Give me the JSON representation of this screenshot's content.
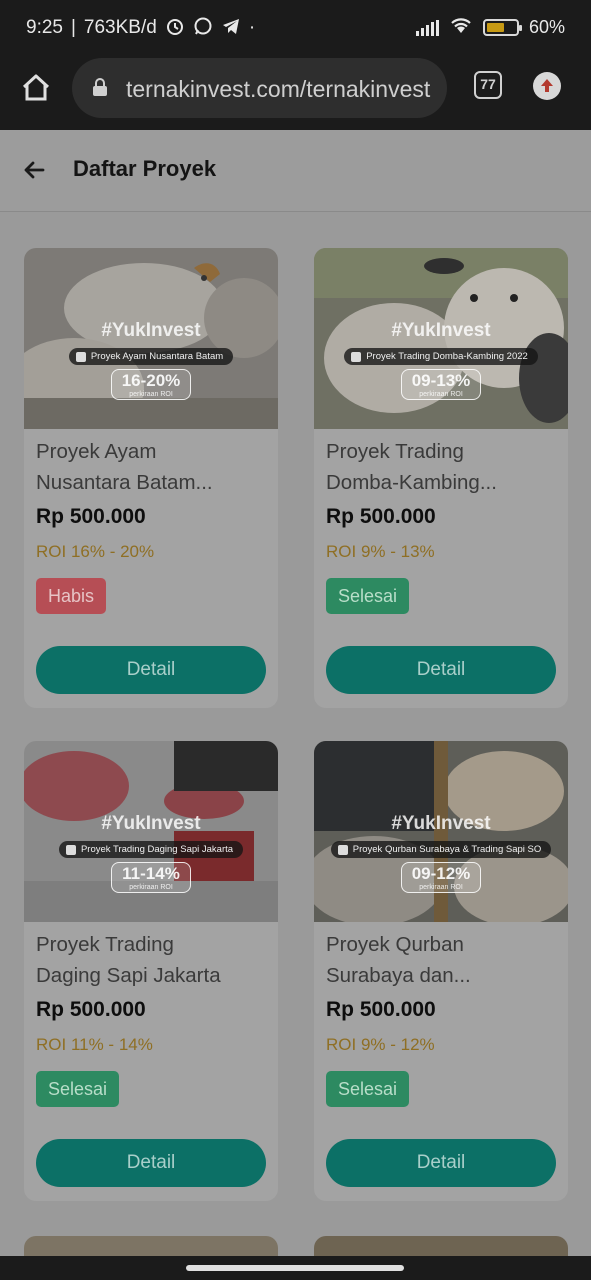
{
  "status_bar": {
    "time": "9:25",
    "separator": "|",
    "net_speed": "763KB/d",
    "dot": "·",
    "battery_pct": "60%",
    "battery_level": 0.6,
    "icons": [
      "alarm-icon",
      "whatsapp-icon",
      "telegram-icon",
      "signal-icon",
      "wifi-icon",
      "battery-icon"
    ]
  },
  "browser": {
    "url": "ternakinvest.com/ternakinvest",
    "tab_count": "77",
    "icons": [
      "home-icon",
      "lock-icon",
      "tabs-icon",
      "update-icon"
    ]
  },
  "header": {
    "title": "Daftar Proyek",
    "back_icon": "arrow-left-icon"
  },
  "projects": [
    {
      "title_line1": "Proyek Ayam",
      "title_line2": "Nusantara Batam...",
      "price": "Rp 500.000",
      "roi": "ROI 16% - 20%",
      "status": "Habis",
      "button": "Detail",
      "banner": {
        "hashtag": "#YukInvest",
        "pill": "Proyek Ayam Nusantara Batam",
        "roi_big": "16-20%",
        "roi_small": "perkiraan ROI"
      }
    },
    {
      "title_line1": "Proyek Trading",
      "title_line2": "Domba-Kambing...",
      "price": "Rp 500.000",
      "roi": "ROI 9% - 13%",
      "status": "Selesai",
      "button": "Detail",
      "banner": {
        "hashtag": "#YukInvest",
        "pill": "Proyek Trading Domba-Kambing 2022",
        "roi_big": "09-13%",
        "roi_small": "perkiraan ROI"
      }
    },
    {
      "title_line1": "Proyek Trading",
      "title_line2": "Daging Sapi Jakarta",
      "price": "Rp 500.000",
      "roi": "ROI 11% - 14%",
      "status": "Selesai",
      "button": "Detail",
      "banner": {
        "hashtag": "#YukInvest",
        "pill": "Proyek Trading Daging Sapi Jakarta",
        "roi_big": "11-14%",
        "roi_small": "perkiraan ROI"
      }
    },
    {
      "title_line1": "Proyek Qurban",
      "title_line2": "Surabaya dan...",
      "price": "Rp 500.000",
      "roi": "ROI 9% - 12%",
      "status": "Selesai",
      "button": "Detail",
      "banner": {
        "hashtag": "#YukInvest",
        "pill": "Proyek Qurban Surabaya & Trading Sapi SO",
        "roi_big": "09-12%",
        "roi_small": "perkiraan ROI"
      }
    }
  ],
  "colors": {
    "status_habis": "#b64e55",
    "status_selesai": "#2d8a61",
    "detail_button": "#0c7066",
    "roi_text": "#8f6f24"
  }
}
